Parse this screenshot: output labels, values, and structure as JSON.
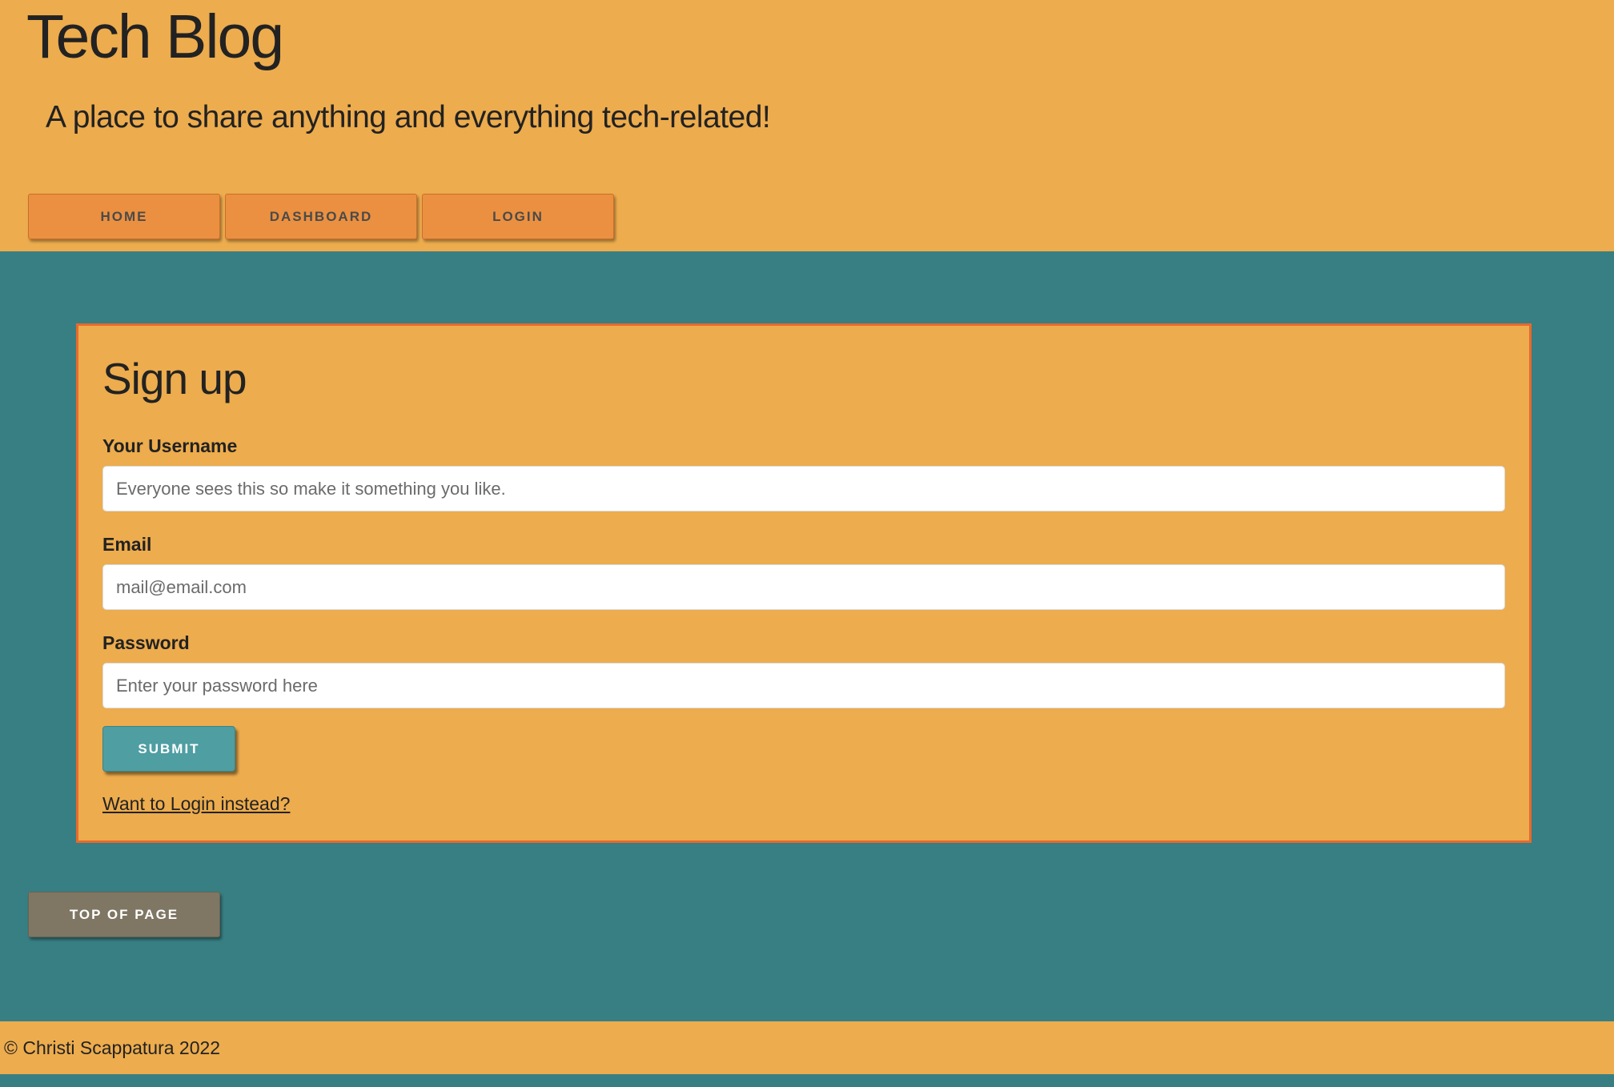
{
  "header": {
    "title": "Tech Blog",
    "tagline": "A place to share anything and everything tech-related!",
    "nav": [
      {
        "label": "HOME"
      },
      {
        "label": "DASHBOARD"
      },
      {
        "label": "LOGIN"
      }
    ]
  },
  "signup": {
    "title": "Sign up",
    "username": {
      "label": "Your Username",
      "placeholder": "Everyone sees this so make it something you like.",
      "value": ""
    },
    "email": {
      "label": "Email",
      "placeholder": "mail@email.com",
      "value": ""
    },
    "password": {
      "label": "Password",
      "placeholder": "Enter your password here",
      "value": ""
    },
    "submit_label": "SUBMIT",
    "login_link": "Want to Login instead?"
  },
  "top_of_page_label": "TOP OF PAGE",
  "footer": {
    "text": "© Christi Scappatura 2022"
  },
  "colors": {
    "header_bg": "#edac4d",
    "page_bg": "#387f83",
    "nav_button": "#eb9040",
    "card_border": "#e8692d",
    "submit_button": "#4e9ea2",
    "top_button": "#7f7764"
  }
}
